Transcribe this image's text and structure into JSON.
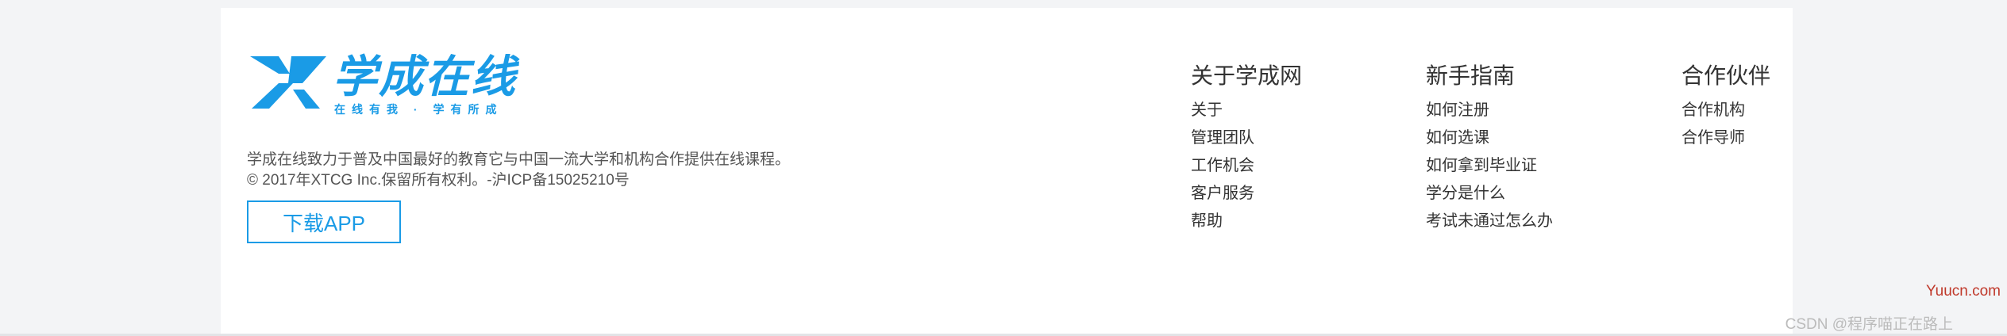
{
  "logo": {
    "title": "学成在线",
    "slogan": "在线有我 · 学有所成",
    "color": "#1a9be6"
  },
  "description": {
    "line1": "学成在线致力于普及中国最好的教育它与中国一流大学和机构合作提供在线课程。",
    "line2": "© 2017年XTCG Inc.保留所有权利。-沪ICP备15025210号"
  },
  "download_button": {
    "label": "下载APP"
  },
  "columns": [
    {
      "title": "关于学成网",
      "items": [
        "关于",
        "管理团队",
        "工作机会",
        "客户服务",
        "帮助"
      ]
    },
    {
      "title": "新手指南",
      "items": [
        "如何注册",
        "如何选课",
        "如何拿到毕业证",
        "学分是什么",
        "考试未通过怎么办"
      ]
    },
    {
      "title": "合作伙伴",
      "items": [
        "合作机构",
        "合作导师"
      ]
    }
  ],
  "watermark": {
    "site": "Yuucn.com",
    "author": "CSDN @程序喵正在路上"
  }
}
